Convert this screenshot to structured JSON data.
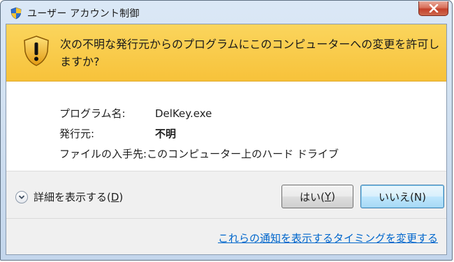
{
  "window": {
    "title": "ユーザー アカウント制御",
    "close_glyph": "X"
  },
  "banner": {
    "message": "次の不明な発行元からのプログラムにこのコンピューターへの変更を許可しますか?",
    "background": "#f7c23a"
  },
  "details": {
    "program_name_label": "プログラム名:",
    "program_name_value": "DelKey.exe",
    "publisher_label": "発行元:",
    "publisher_value": "不明",
    "origin_label": "ファイルの入手先:",
    "origin_value": "このコンピューター上のハード ドライブ"
  },
  "footer": {
    "show_details_text": "詳細を表示する(",
    "show_details_mnemonic": "D",
    "show_details_suffix": ")",
    "yes_text": "はい(",
    "yes_mnemonic": "Y",
    "yes_suffix": ")",
    "no_label": "いいえ(N)",
    "notification_link": "これらの通知を表示するタイミングを変更する"
  },
  "icons": {
    "title": "uac-shield-icon",
    "banner": "warning-shield-icon",
    "expander": "chevron-down-icon",
    "close": "close-icon"
  }
}
